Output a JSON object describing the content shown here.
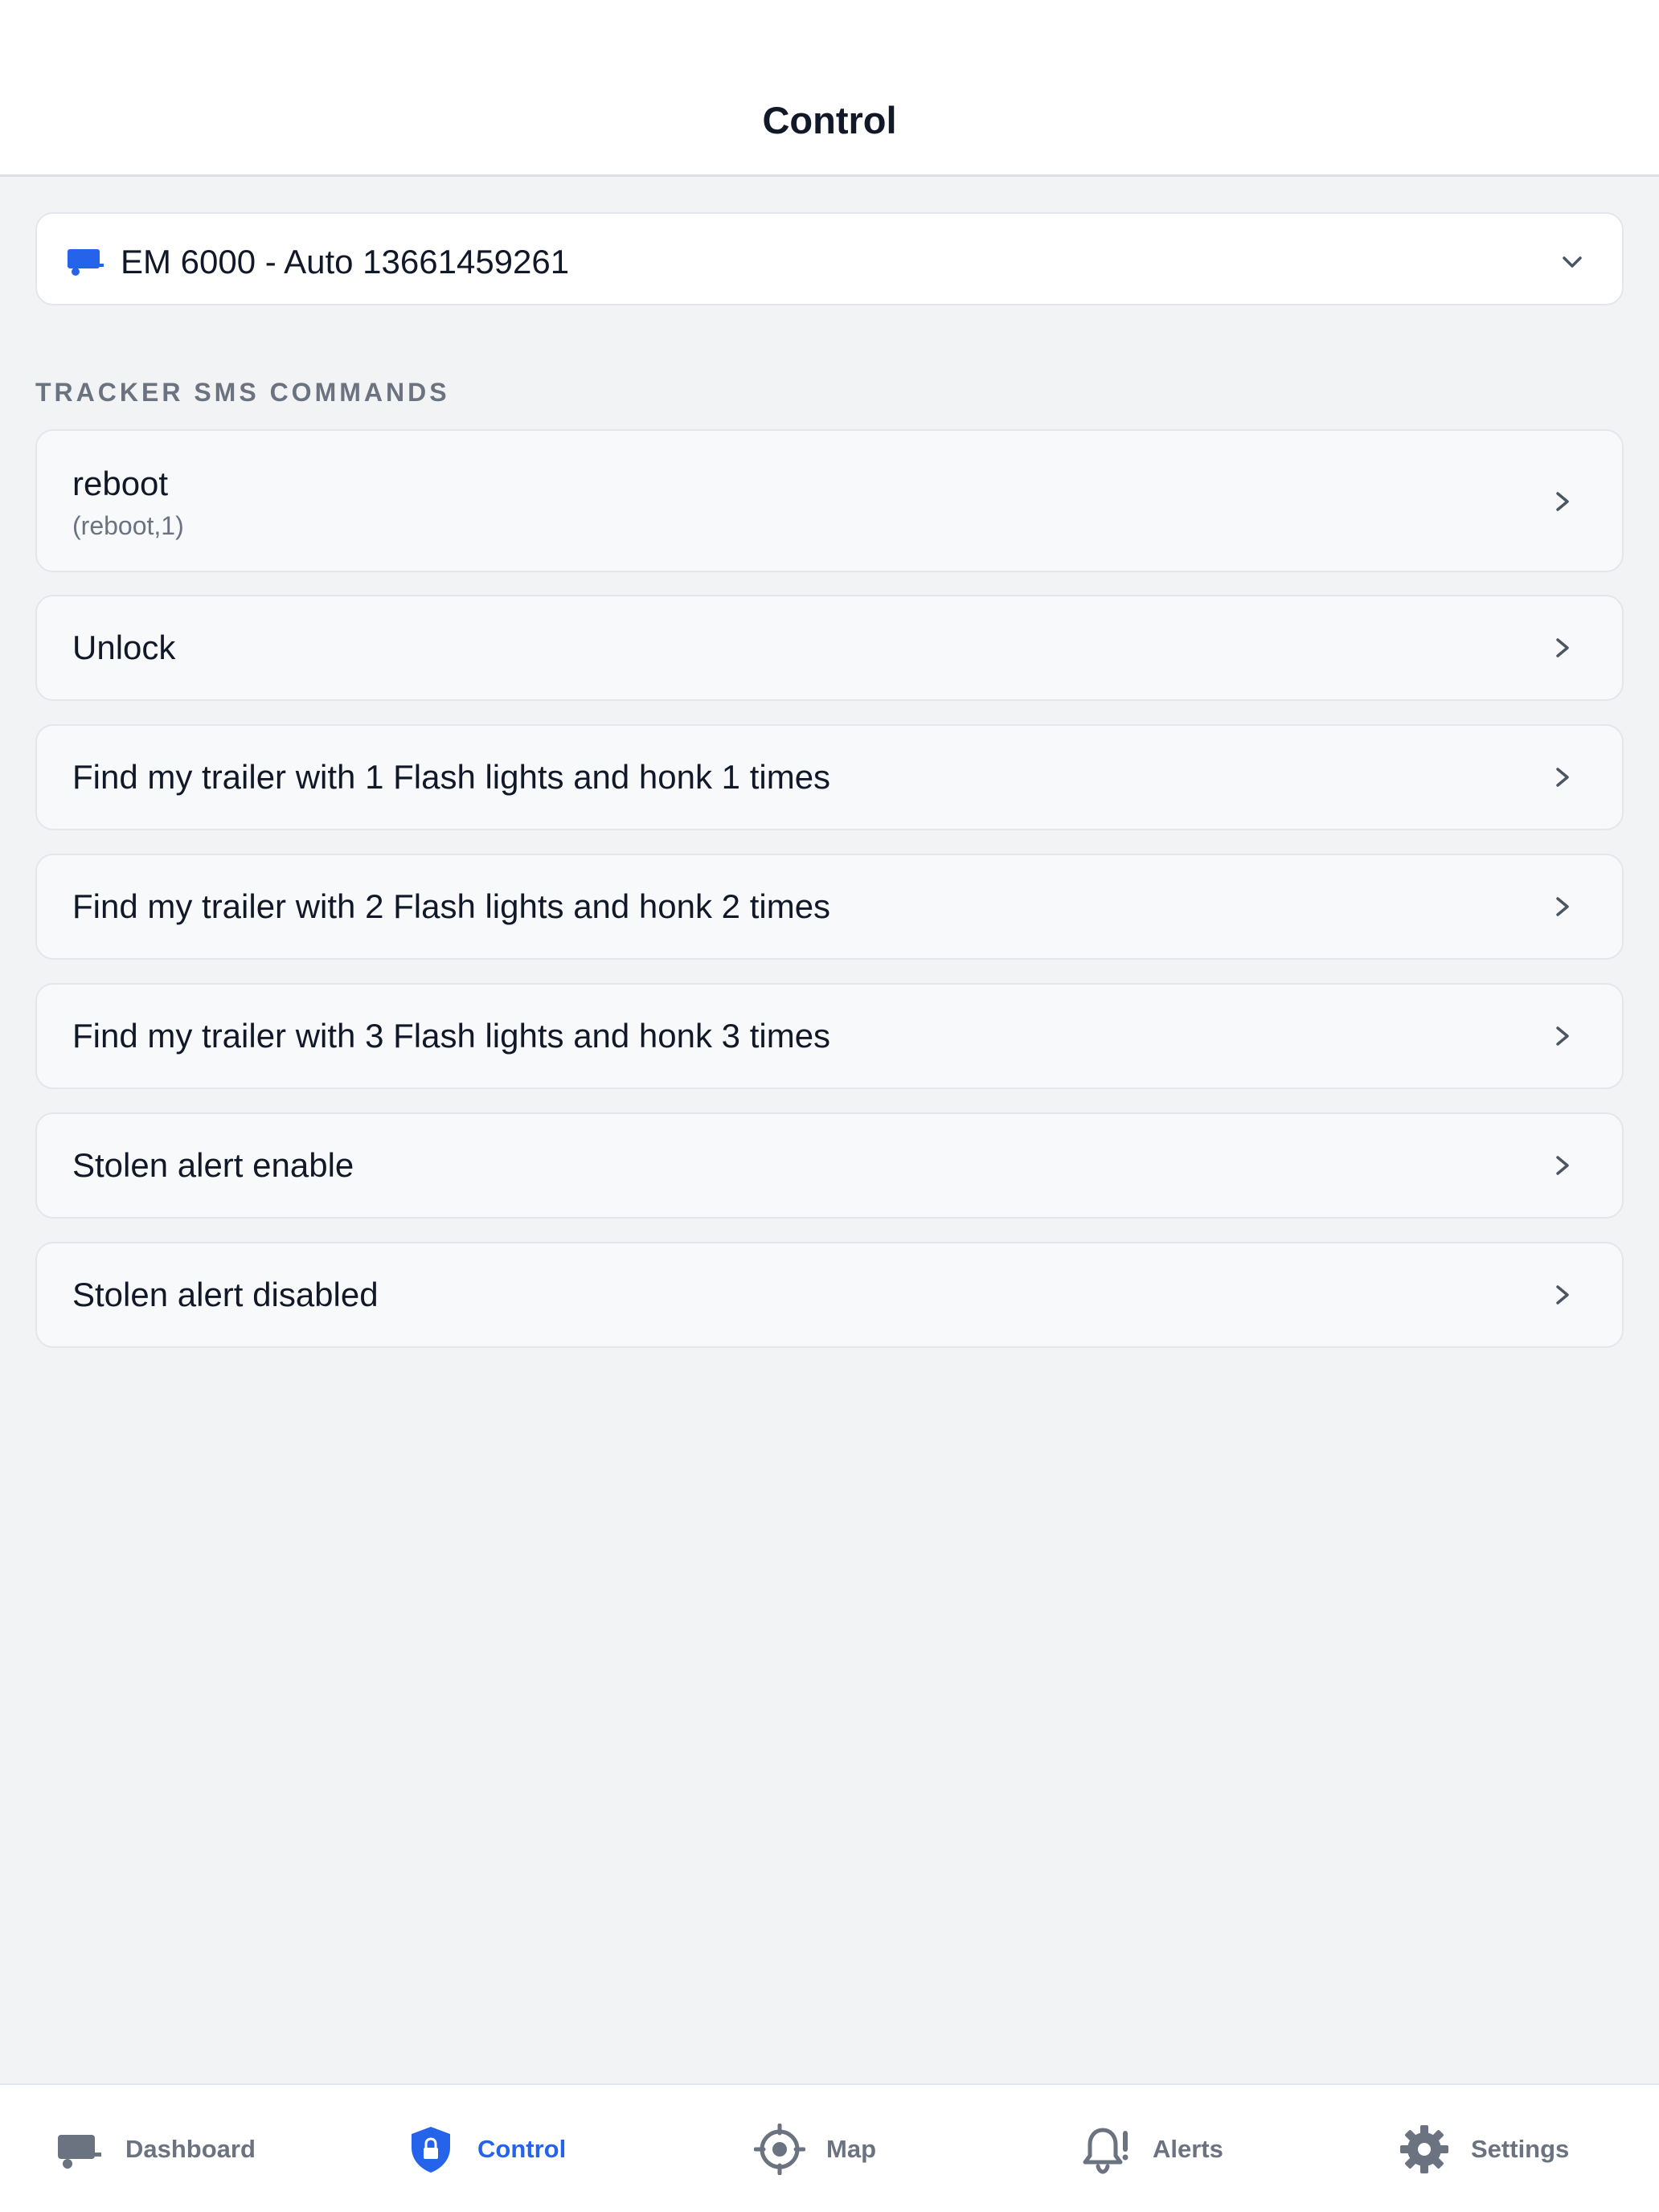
{
  "header": {
    "title": "Control"
  },
  "device_selector": {
    "icon": "trailer-icon",
    "label": "EM 6000 - Auto 13661459261",
    "chevron": "chevron-down-icon"
  },
  "section": {
    "title": "TRACKER SMS COMMANDS"
  },
  "commands": [
    {
      "title": "reboot",
      "subtitle": "(reboot,1)"
    },
    {
      "title": "Unlock"
    },
    {
      "title": "Find my trailer with 1 Flash lights and honk 1 times"
    },
    {
      "title": "Find my trailer with 2 Flash lights and honk 2 times"
    },
    {
      "title": "Find my trailer with 3 Flash lights and honk 3 times"
    },
    {
      "title": "Stolen alert enable"
    },
    {
      "title": "Stolen alert disabled"
    }
  ],
  "tabs": [
    {
      "label": "Dashboard",
      "icon": "trailer-icon",
      "active": false
    },
    {
      "label": "Control",
      "icon": "shield-lock-icon",
      "active": true
    },
    {
      "label": "Map",
      "icon": "crosshair-icon",
      "active": false
    },
    {
      "label": "Alerts",
      "icon": "bell-alert-icon",
      "active": false
    },
    {
      "label": "Settings",
      "icon": "gear-icon",
      "active": false
    }
  ],
  "colors": {
    "accent": "#2563eb",
    "background": "#f2f3f5",
    "muted_text": "#6b7280",
    "primary_text": "#111827"
  }
}
